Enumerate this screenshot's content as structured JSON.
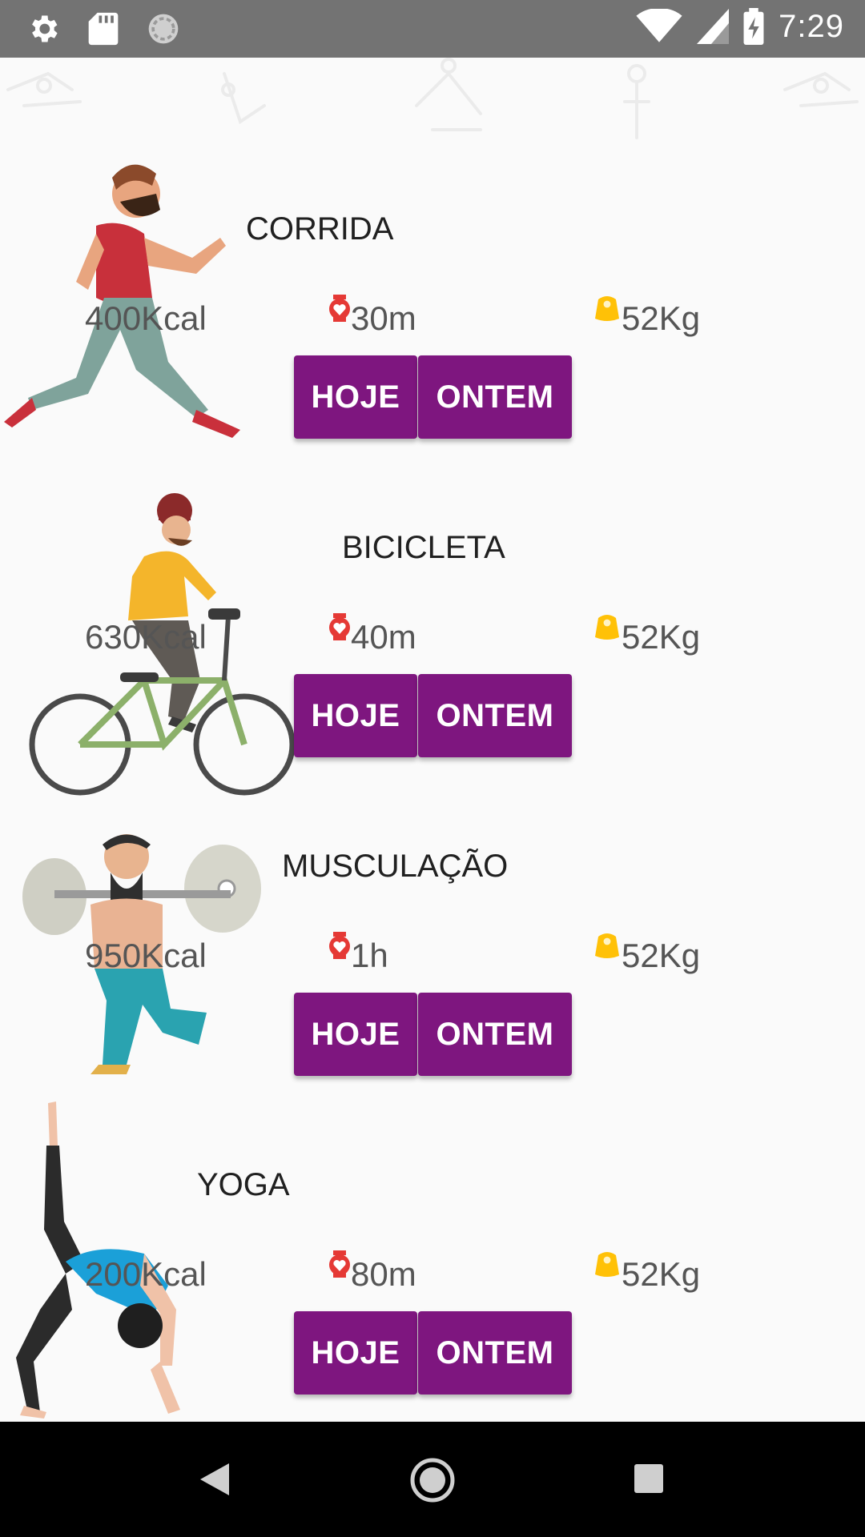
{
  "status_bar": {
    "time": "7:29",
    "left_icons": [
      "settings-icon",
      "sd-card-icon",
      "sync-icon"
    ],
    "right_icons": [
      "wifi-icon",
      "cell-signal-icon",
      "battery-charging-icon"
    ]
  },
  "activities": [
    {
      "title": "CORRIDA",
      "kcal": "400Kcal",
      "time": "30m",
      "weight": "52Kg",
      "today_label": "HOJE",
      "yesterday_label": "ONTEM"
    },
    {
      "title": "BICICLETA",
      "kcal": "630Kcal",
      "time": "40m",
      "weight": "52Kg",
      "today_label": "HOJE",
      "yesterday_label": "ONTEM"
    },
    {
      "title": "MUSCULAÇÃO",
      "kcal": "950Kcal",
      "time": "1h",
      "weight": "52Kg",
      "today_label": "HOJE",
      "yesterday_label": "ONTEM"
    },
    {
      "title": "YOGA",
      "kcal": "200Kcal",
      "time": "80m",
      "weight": "52Kg",
      "today_label": "HOJE",
      "yesterday_label": "ONTEM"
    }
  ],
  "colors": {
    "button": "#7e167f",
    "status_bar": "#737373",
    "nav_bar": "#000000",
    "heart_icon": "#e53935",
    "weight_icon": "#ffc107"
  },
  "nav_bar": [
    "back-icon",
    "home-icon",
    "recents-icon"
  ]
}
